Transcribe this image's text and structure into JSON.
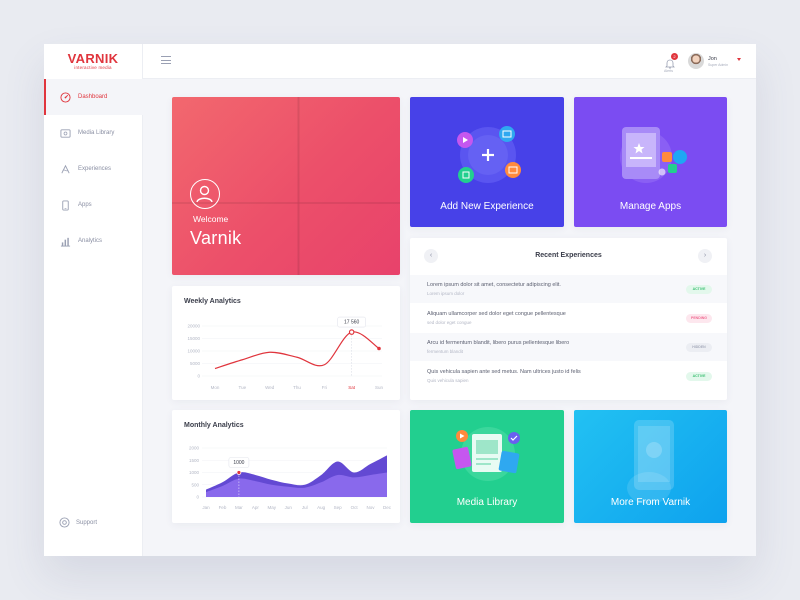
{
  "brand": {
    "name": "VARNIK",
    "subtitle": "interactive media",
    "accent": "#e0353d"
  },
  "sidebar": {
    "items": [
      {
        "label": "Dashboard",
        "icon": "dashboard-icon",
        "active": true
      },
      {
        "label": "Media Library",
        "icon": "media-icon",
        "active": false
      },
      {
        "label": "Experiences",
        "icon": "experiences-icon",
        "active": false
      },
      {
        "label": "Apps",
        "icon": "apps-icon",
        "active": false
      },
      {
        "label": "Analytics",
        "icon": "analytics-icon",
        "active": false
      }
    ],
    "support_label": "Support"
  },
  "topbar": {
    "notifications_count": "2",
    "notifications_label": "Alerts",
    "user_name": "Jon",
    "user_role": "Super Admin"
  },
  "welcome": {
    "label": "Welcome",
    "name": "Varnik"
  },
  "tiles": {
    "add_experience": "Add New Experience",
    "manage_apps": "Manage Apps",
    "media_library": "Media Library",
    "more": "More From Varnik"
  },
  "recent": {
    "title": "Recent Experiences",
    "rows": [
      {
        "title": "Lorem ipsum dolor sit amet, consectetur adipiscing elit.",
        "sub": "Lorem ipsum dolor",
        "status": "ACTIVE"
      },
      {
        "title": "Aliquam ullamcorper sed dolor eget congue pellentesque",
        "sub": "sed dolor eget congue",
        "status": "PENDING"
      },
      {
        "title": "Arcu id fermentum blandit, libero purus pellentesque libero",
        "sub": "fermentum blandit",
        "status": "HIDDEN"
      },
      {
        "title": "Quis vehicula sapien ante sed metus. Nam ultrices justo id felis",
        "sub": "Quis vehicula sapien",
        "status": "ACTIVE"
      }
    ],
    "status_colors": {
      "ACTIVE": {
        "bg": "#e3f8ec",
        "fg": "#3bbf72"
      },
      "PENDING": {
        "bg": "#fde7ee",
        "fg": "#ef6b91"
      },
      "HIDDEN": {
        "bg": "#eceef3",
        "fg": "#a6abbb"
      }
    }
  },
  "chart_data": [
    {
      "type": "line",
      "title": "Weekly Analytics",
      "categories": [
        "Mon",
        "Tue",
        "Wed",
        "Thu",
        "Fri",
        "Sat",
        "Sun"
      ],
      "values": [
        3000,
        6500,
        9500,
        7500,
        4500,
        17560,
        11000
      ],
      "yticks": [
        "20000",
        "15000",
        "10000",
        "5000",
        "0"
      ],
      "ylim": [
        0,
        20000
      ],
      "highlight_index": 5,
      "highlight_label": "17 560",
      "color": "#e0353d"
    },
    {
      "type": "area",
      "title": "Monthly Analytics",
      "categories": [
        "Jan",
        "Feb",
        "Mar",
        "Apr",
        "May",
        "Jun",
        "Jul",
        "Aug",
        "Sep",
        "Oct",
        "Nov",
        "Dec"
      ],
      "series": [
        {
          "values": [
            300,
            600,
            1000,
            900,
            700,
            550,
            500,
            900,
            1450,
            1000,
            1350,
            1700
          ]
        },
        {
          "values": [
            200,
            450,
            750,
            650,
            500,
            420,
            380,
            600,
            900,
            800,
            900,
            1000
          ]
        }
      ],
      "yticks": [
        "2000",
        "1500",
        "1000",
        "500",
        "0"
      ],
      "ylim": [
        0,
        2000
      ],
      "highlight_index": 2,
      "highlight_label": "1000",
      "colors": [
        "#5b3fd1",
        "#8f6ff0"
      ]
    }
  ]
}
